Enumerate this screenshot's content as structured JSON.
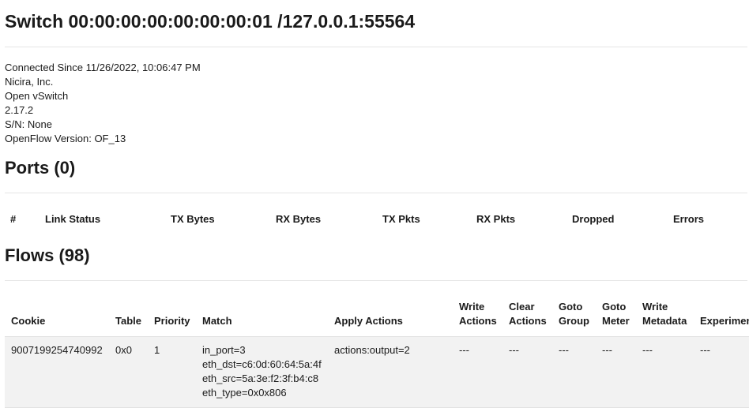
{
  "switch": {
    "title": "Switch 00:00:00:00:00:00:00:01 /127.0.0.1:55564",
    "connected_since": "Connected Since 11/26/2022, 10:06:47 PM",
    "manufacturer": "Nicira, Inc.",
    "hardware": "Open vSwitch",
    "software_version": "2.17.2",
    "serial": "S/N: None",
    "openflow_version": "OpenFlow Version: OF_13"
  },
  "ports": {
    "heading": "Ports (0)",
    "columns": [
      "#",
      "Link Status",
      "TX Bytes",
      "RX Bytes",
      "TX Pkts",
      "RX Pkts",
      "Dropped",
      "Errors"
    ]
  },
  "flows": {
    "heading": "Flows (98)",
    "columns": {
      "cookie": "Cookie",
      "table": "Table",
      "priority": "Priority",
      "match": "Match",
      "apply_actions": "Apply Actions",
      "write_actions": [
        "Write",
        "Actions"
      ],
      "clear_actions": [
        "Clear",
        "Actions"
      ],
      "goto_group": [
        "Goto",
        "Group"
      ],
      "goto_meter": [
        "Goto",
        "Meter"
      ],
      "write_metadata": [
        "Write",
        "Metadata"
      ],
      "experimenter": "Experimenter"
    },
    "rows": [
      {
        "cookie": "9007199254740992",
        "table": "0x0",
        "priority": "1",
        "match": [
          "in_port=3",
          "eth_dst=c6:0d:60:64:5a:4f",
          "eth_src=5a:3e:f2:3f:b4:c8",
          "eth_type=0x0x806"
        ],
        "apply_actions": "actions:output=2",
        "write_actions": "---",
        "clear_actions": "---",
        "goto_group": "---",
        "goto_meter": "---",
        "write_metadata": "---",
        "experimenter": "---"
      }
    ]
  }
}
